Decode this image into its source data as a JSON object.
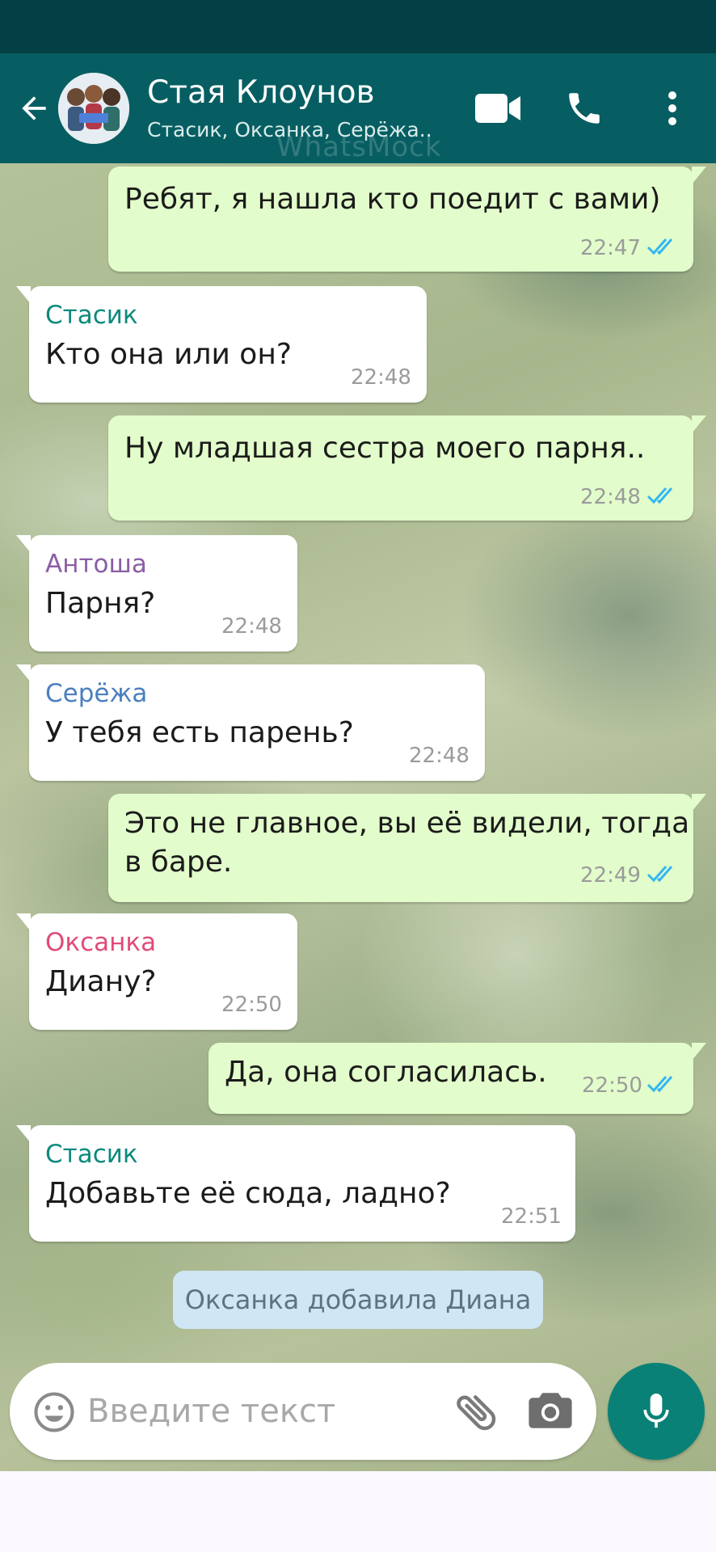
{
  "header": {
    "title": "Стая Клоунов",
    "subtitle": "Стасик, Оксанка, Серёжа..",
    "watermark": "WhatsMock"
  },
  "messages": [
    {
      "direction": "out",
      "text": "Ребят, я нашла кто поедит с вами)",
      "time": "22:47",
      "read": true
    },
    {
      "direction": "in",
      "sender": "Стасик",
      "sender_color": "#0d8a7d",
      "text": "Кто она или он?",
      "time": "22:48"
    },
    {
      "direction": "out",
      "text": "Ну младшая сестра моего парня..",
      "time": "22:48",
      "read": true
    },
    {
      "direction": "in",
      "sender": "Антоша",
      "sender_color": "#8b5ea6",
      "text": "Парня?",
      "time": "22:48"
    },
    {
      "direction": "in",
      "sender": "Серёжа",
      "sender_color": "#4b7fc0",
      "text": "У тебя есть парень?",
      "time": "22:48"
    },
    {
      "direction": "out",
      "text_lines": [
        "Это не главное, вы её видели, тогда",
        "в баре."
      ],
      "time": "22:49",
      "read": true
    },
    {
      "direction": "in",
      "sender": "Оксанка",
      "sender_color": "#e04b78",
      "text": "Диану?",
      "time": "22:50"
    },
    {
      "direction": "out",
      "text": "Да, она согласилась.",
      "time": "22:50",
      "read": true
    },
    {
      "direction": "in",
      "sender": "Стасик",
      "sender_color": "#0d8a7d",
      "text": "Добавьте её сюда, ладно?",
      "time": "22:51"
    }
  ],
  "system_message": "Оксанка добавила Диана",
  "input": {
    "placeholder": "Введите текст",
    "value": ""
  },
  "colors": {
    "header_bg": "#075e62",
    "status_bar": "#033f44",
    "out_bubble": "#e2fdcb",
    "in_bubble": "#ffffff",
    "read_ticks": "#34b7f1",
    "mic_button": "#0a8177",
    "system_bubble": "#cfe6f5"
  },
  "icons": [
    "back-arrow-icon",
    "group-avatar",
    "video-camera-icon",
    "phone-icon",
    "more-vertical-icon",
    "emoji-icon",
    "paperclip-icon",
    "camera-icon",
    "microphone-icon",
    "double-check-icon"
  ]
}
